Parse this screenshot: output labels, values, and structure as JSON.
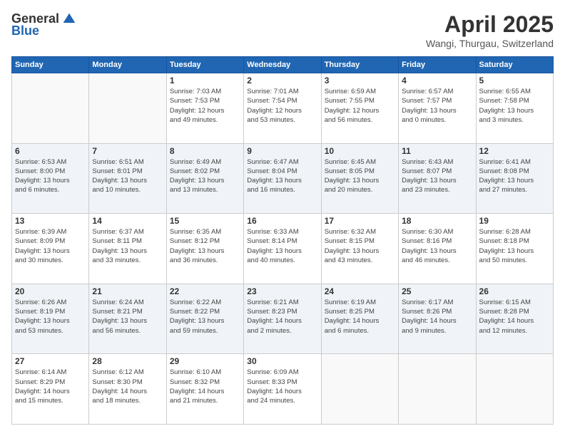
{
  "header": {
    "logo_general": "General",
    "logo_blue": "Blue",
    "month": "April 2025",
    "location": "Wangi, Thurgau, Switzerland"
  },
  "days_of_week": [
    "Sunday",
    "Monday",
    "Tuesday",
    "Wednesday",
    "Thursday",
    "Friday",
    "Saturday"
  ],
  "weeks": [
    {
      "days": [
        {
          "num": "",
          "info": ""
        },
        {
          "num": "",
          "info": ""
        },
        {
          "num": "1",
          "info": "Sunrise: 7:03 AM\nSunset: 7:53 PM\nDaylight: 12 hours\nand 49 minutes."
        },
        {
          "num": "2",
          "info": "Sunrise: 7:01 AM\nSunset: 7:54 PM\nDaylight: 12 hours\nand 53 minutes."
        },
        {
          "num": "3",
          "info": "Sunrise: 6:59 AM\nSunset: 7:55 PM\nDaylight: 12 hours\nand 56 minutes."
        },
        {
          "num": "4",
          "info": "Sunrise: 6:57 AM\nSunset: 7:57 PM\nDaylight: 13 hours\nand 0 minutes."
        },
        {
          "num": "5",
          "info": "Sunrise: 6:55 AM\nSunset: 7:58 PM\nDaylight: 13 hours\nand 3 minutes."
        }
      ]
    },
    {
      "days": [
        {
          "num": "6",
          "info": "Sunrise: 6:53 AM\nSunset: 8:00 PM\nDaylight: 13 hours\nand 6 minutes."
        },
        {
          "num": "7",
          "info": "Sunrise: 6:51 AM\nSunset: 8:01 PM\nDaylight: 13 hours\nand 10 minutes."
        },
        {
          "num": "8",
          "info": "Sunrise: 6:49 AM\nSunset: 8:02 PM\nDaylight: 13 hours\nand 13 minutes."
        },
        {
          "num": "9",
          "info": "Sunrise: 6:47 AM\nSunset: 8:04 PM\nDaylight: 13 hours\nand 16 minutes."
        },
        {
          "num": "10",
          "info": "Sunrise: 6:45 AM\nSunset: 8:05 PM\nDaylight: 13 hours\nand 20 minutes."
        },
        {
          "num": "11",
          "info": "Sunrise: 6:43 AM\nSunset: 8:07 PM\nDaylight: 13 hours\nand 23 minutes."
        },
        {
          "num": "12",
          "info": "Sunrise: 6:41 AM\nSunset: 8:08 PM\nDaylight: 13 hours\nand 27 minutes."
        }
      ]
    },
    {
      "days": [
        {
          "num": "13",
          "info": "Sunrise: 6:39 AM\nSunset: 8:09 PM\nDaylight: 13 hours\nand 30 minutes."
        },
        {
          "num": "14",
          "info": "Sunrise: 6:37 AM\nSunset: 8:11 PM\nDaylight: 13 hours\nand 33 minutes."
        },
        {
          "num": "15",
          "info": "Sunrise: 6:35 AM\nSunset: 8:12 PM\nDaylight: 13 hours\nand 36 minutes."
        },
        {
          "num": "16",
          "info": "Sunrise: 6:33 AM\nSunset: 8:14 PM\nDaylight: 13 hours\nand 40 minutes."
        },
        {
          "num": "17",
          "info": "Sunrise: 6:32 AM\nSunset: 8:15 PM\nDaylight: 13 hours\nand 43 minutes."
        },
        {
          "num": "18",
          "info": "Sunrise: 6:30 AM\nSunset: 8:16 PM\nDaylight: 13 hours\nand 46 minutes."
        },
        {
          "num": "19",
          "info": "Sunrise: 6:28 AM\nSunset: 8:18 PM\nDaylight: 13 hours\nand 50 minutes."
        }
      ]
    },
    {
      "days": [
        {
          "num": "20",
          "info": "Sunrise: 6:26 AM\nSunset: 8:19 PM\nDaylight: 13 hours\nand 53 minutes."
        },
        {
          "num": "21",
          "info": "Sunrise: 6:24 AM\nSunset: 8:21 PM\nDaylight: 13 hours\nand 56 minutes."
        },
        {
          "num": "22",
          "info": "Sunrise: 6:22 AM\nSunset: 8:22 PM\nDaylight: 13 hours\nand 59 minutes."
        },
        {
          "num": "23",
          "info": "Sunrise: 6:21 AM\nSunset: 8:23 PM\nDaylight: 14 hours\nand 2 minutes."
        },
        {
          "num": "24",
          "info": "Sunrise: 6:19 AM\nSunset: 8:25 PM\nDaylight: 14 hours\nand 6 minutes."
        },
        {
          "num": "25",
          "info": "Sunrise: 6:17 AM\nSunset: 8:26 PM\nDaylight: 14 hours\nand 9 minutes."
        },
        {
          "num": "26",
          "info": "Sunrise: 6:15 AM\nSunset: 8:28 PM\nDaylight: 14 hours\nand 12 minutes."
        }
      ]
    },
    {
      "days": [
        {
          "num": "27",
          "info": "Sunrise: 6:14 AM\nSunset: 8:29 PM\nDaylight: 14 hours\nand 15 minutes."
        },
        {
          "num": "28",
          "info": "Sunrise: 6:12 AM\nSunset: 8:30 PM\nDaylight: 14 hours\nand 18 minutes."
        },
        {
          "num": "29",
          "info": "Sunrise: 6:10 AM\nSunset: 8:32 PM\nDaylight: 14 hours\nand 21 minutes."
        },
        {
          "num": "30",
          "info": "Sunrise: 6:09 AM\nSunset: 8:33 PM\nDaylight: 14 hours\nand 24 minutes."
        },
        {
          "num": "",
          "info": ""
        },
        {
          "num": "",
          "info": ""
        },
        {
          "num": "",
          "info": ""
        }
      ]
    }
  ]
}
